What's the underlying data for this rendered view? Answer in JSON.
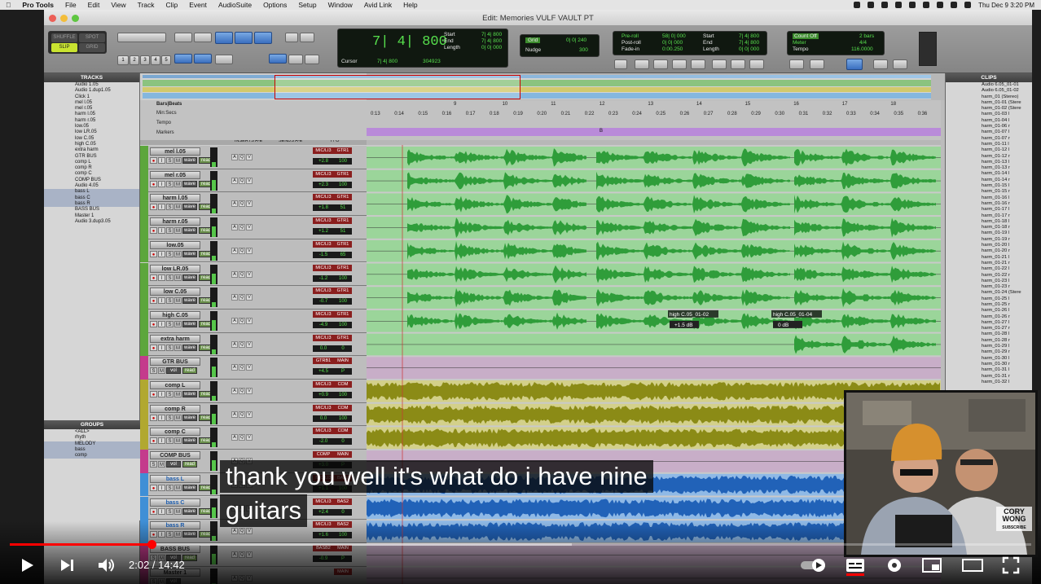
{
  "menubar": {
    "items": [
      "Pro Tools",
      "File",
      "Edit",
      "View",
      "Track",
      "Clip",
      "Event",
      "AudioSuite",
      "Options",
      "Setup",
      "Window",
      "Avid Link",
      "Help"
    ],
    "datetime": "Thu Dec 9  3:20 PM"
  },
  "window": {
    "title": "Edit: Memories VULF VAULT PT"
  },
  "toolbar": {
    "modes": [
      "SHUFFLE",
      "SPOT",
      "SLIP",
      "GRID"
    ],
    "zoom_presets": [
      "1",
      "2",
      "3",
      "4",
      "5"
    ],
    "main_counter": "7| 4| 800",
    "start_label": "Start",
    "end_label": "End",
    "length_label": "Length",
    "start": "7| 4| 800",
    "end": "7| 4| 800",
    "length": "0| 0| 000",
    "cursor_label": "Cursor",
    "cursor": "7| 4| 800",
    "cursor_sample": "304923",
    "grid_label": "Grid",
    "grid_value": "0| 0| 240",
    "nudge_label": "Nudge",
    "nudge_value": "300",
    "preroll_label": "Pre-roll",
    "postroll_label": "Post-roll",
    "fadein_label": "Fade-in",
    "preroll": "58| 0| 000",
    "postroll": "0| 0| 000",
    "fadein": "0:00.250",
    "tstart": "7| 4| 800",
    "tend": "7| 4| 800",
    "tlength": "0| 0| 000",
    "countoff_label": "Count Off",
    "countoff": "2 bars",
    "meter_label": "Meter",
    "meter": "4/4",
    "tempo_label": "Tempo",
    "tempo": "116.0000"
  },
  "panels": {
    "tracks_header": "TRACKS",
    "groups_header": "GROUPS",
    "clips_header": "CLIPS"
  },
  "track_list": [
    "Audio 1.05",
    "Audio 1.dup1.05",
    "Click 1",
    "mel l.05",
    "mel r.05",
    "harm l.05",
    "harm r.05",
    "low.05",
    "low LR.05",
    "low C.05",
    "high C.05",
    "extra harm",
    "GTR BUS",
    "comp L",
    "comp R",
    "comp C",
    "COMP BUS",
    "Audio 4.05",
    "bass L",
    "bass C",
    "bass R",
    "BASS BUS",
    "Master 1",
    "Audio 3.dup3.05"
  ],
  "groups": [
    "<ALL>",
    "rhyth",
    "MELODY",
    "bass",
    "comp"
  ],
  "rulers": {
    "bars_label": "Bars|Beats",
    "minsecs_label": "Min:Secs",
    "tempo_label": "Tempo",
    "markers_label": "Markers",
    "bars": [
      "9",
      "10",
      "11",
      "12",
      "13",
      "14",
      "15",
      "16",
      "17",
      "18"
    ],
    "secs": [
      "0:13",
      "0:14",
      "0:15",
      "0:16",
      "0:17",
      "0:18",
      "0:19",
      "0:20",
      "0:21",
      "0:22",
      "0:23",
      "0:24",
      "0:25",
      "0:26",
      "0:27",
      "0:28",
      "0:29",
      "0:30",
      "0:31",
      "0:32",
      "0:33",
      "0:34",
      "0:35",
      "0:36"
    ],
    "marker": "B"
  },
  "column_headers": {
    "inserts": "INSERTS A-E",
    "sends": "SENDS A-E",
    "io": "I / O"
  },
  "tracks": [
    {
      "name": "mel l.05",
      "color": "#5ca63c",
      "io_in": "MIC/LI3",
      "io_out": "GTR1",
      "vol": "+2.8",
      "pan": "100",
      "mode": "read",
      "kind": "audio"
    },
    {
      "name": "mel r.05",
      "color": "#5ca63c",
      "io_in": "MIC/LI3",
      "io_out": "GTR1",
      "vol": "+2.3",
      "pan": "100",
      "mode": "read",
      "kind": "audio"
    },
    {
      "name": "harm l.05",
      "color": "#5ca63c",
      "io_in": "MIC/LI3",
      "io_out": "GTR1",
      "vol": "+1.8",
      "pan": "51",
      "mode": "read",
      "kind": "audio"
    },
    {
      "name": "harm r.05",
      "color": "#5ca63c",
      "io_in": "MIC/LI3",
      "io_out": "GTR1",
      "vol": "+1.2",
      "pan": "51",
      "mode": "read",
      "kind": "audio"
    },
    {
      "name": "low.05",
      "color": "#5ca63c",
      "io_in": "MIC/LI3",
      "io_out": "GTR1",
      "vol": "-1.5",
      "pan": "65",
      "mode": "read",
      "kind": "audio"
    },
    {
      "name": "low LR.05",
      "color": "#5ca63c",
      "io_in": "MIC/LI3",
      "io_out": "GTR1",
      "vol": "-1.2",
      "pan": "100",
      "mode": "read",
      "kind": "audio"
    },
    {
      "name": "low C.05",
      "color": "#5ca63c",
      "io_in": "MIC/LI3",
      "io_out": "GTR1",
      "vol": "-0.7",
      "pan": "100",
      "mode": "read",
      "kind": "audio"
    },
    {
      "name": "high C.05",
      "color": "#5ca63c",
      "io_in": "MIC/LI3",
      "io_out": "GTR1",
      "vol": "-4.9",
      "pan": "100",
      "mode": "read",
      "kind": "audio"
    },
    {
      "name": "extra harm",
      "color": "#5ca63c",
      "io_in": "MIC/LI3",
      "io_out": "GTR1",
      "vol": "0.0",
      "pan": "0",
      "mode": "read",
      "kind": "audio"
    },
    {
      "name": "GTR BUS",
      "color": "#c43b8c",
      "io_in": "GTRB1",
      "io_out": "MAIN",
      "vol": "+4.5",
      "pan": "P",
      "mode": "read",
      "kind": "aux"
    },
    {
      "name": "comp L",
      "color": "#b1a830",
      "io_in": "MIC/LI3",
      "io_out": "COM",
      "vol": "+0.9",
      "pan": "100",
      "mode": "read",
      "kind": "audio"
    },
    {
      "name": "comp R",
      "color": "#b1a830",
      "io_in": "MIC/LI3",
      "io_out": "COM",
      "vol": "0.0",
      "pan": "100",
      "mode": "read",
      "kind": "audio"
    },
    {
      "name": "comp C",
      "color": "#b1a830",
      "io_in": "MIC/LI3",
      "io_out": "COM",
      "vol": "-2.0",
      "pan": "0",
      "mode": "read",
      "kind": "audio"
    },
    {
      "name": "COMP BUS",
      "color": "#c43b8c",
      "io_in": "COMP",
      "io_out": "MAIN",
      "vol": "+3.0",
      "pan": "P",
      "mode": "read",
      "kind": "aux"
    },
    {
      "name": "bass L",
      "color": "#3f8fd6",
      "io_in": "MIC/LI3",
      "io_out": "BAS2",
      "vol": "+1.1",
      "pan": "100",
      "mode": "read",
      "kind": "audio"
    },
    {
      "name": "bass C",
      "color": "#3f8fd6",
      "io_in": "MIC/LI3",
      "io_out": "BAS2",
      "vol": "+2.4",
      "pan": "0",
      "mode": "read",
      "kind": "audio"
    },
    {
      "name": "bass R",
      "color": "#3f8fd6",
      "io_in": "MIC/LI3",
      "io_out": "BAS2",
      "vol": "+1.6",
      "pan": "100",
      "mode": "read",
      "kind": "audio"
    },
    {
      "name": "BASS BUS",
      "color": "#c43b8c",
      "io_in": "BASB2",
      "io_out": "MAIN",
      "vol": "-0.9",
      "pan": "P",
      "mode": "read",
      "kind": "aux"
    },
    {
      "name": "Master 1",
      "color": "#c43b8c",
      "io_in": "",
      "io_out": "MAIN",
      "vol": "",
      "pan": "",
      "mode": "",
      "kind": "aux"
    }
  ],
  "clip_labels": [
    {
      "name": "high C.05_01-02",
      "gain": "+1.5 dB"
    },
    {
      "name": "high C.05_01-04",
      "gain": "0 dB"
    }
  ],
  "clips_list": [
    "Audio 6.05_01-01",
    "Audio 6.05_01-02",
    "harm_01 (Stereo)",
    "harm_01-01 (Stere",
    "harm_01-02 (Stere",
    "harm_01-03 l",
    "harm_01-04 l",
    "harm_01-06 r",
    "harm_01-07 l",
    "harm_01-07 r",
    "harm_01-11 l",
    "harm_01-12 l",
    "harm_01-12 r",
    "harm_01-13 l",
    "harm_01-13 r",
    "harm_01-14 l",
    "harm_01-14 r",
    "harm_01-15 l",
    "harm_01-15 r",
    "harm_01-16 l",
    "harm_01-16 r",
    "harm_01-17 l",
    "harm_01-17 r",
    "harm_01-18 l",
    "harm_01-18 r",
    "harm_01-19 l",
    "harm_01-19 r",
    "harm_01-20 l",
    "harm_01-20 r",
    "harm_01-21 l",
    "harm_01-21 r",
    "harm_01-22 l",
    "harm_01-22 r",
    "harm_01-23 l",
    "harm_01-23 r",
    "harm_01-24 (Stere",
    "harm_01-25 l",
    "harm_01-25 r",
    "harm_01-26 l",
    "harm_01-26 r",
    "harm_01-27 l",
    "harm_01-27 r",
    "harm_01-28 l",
    "harm_01-28 r",
    "harm_01-29 l",
    "harm_01-29 r",
    "harm_01-30 l",
    "harm_01-30 r",
    "harm_01-31 l",
    "harm_01-31 r",
    "harm_01-32 l"
  ],
  "subtitles": [
    "thank you well it's what do i have nine",
    "guitars"
  ],
  "video": {
    "current": "2:02",
    "duration": "14:42",
    "time_text": "2:02 / 14:42",
    "progress_fraction": 0.139,
    "buffer_fraction": 0.55,
    "pip_badge": "CORY WONG",
    "pip_badge_sub": "SUBSCRIBE"
  }
}
